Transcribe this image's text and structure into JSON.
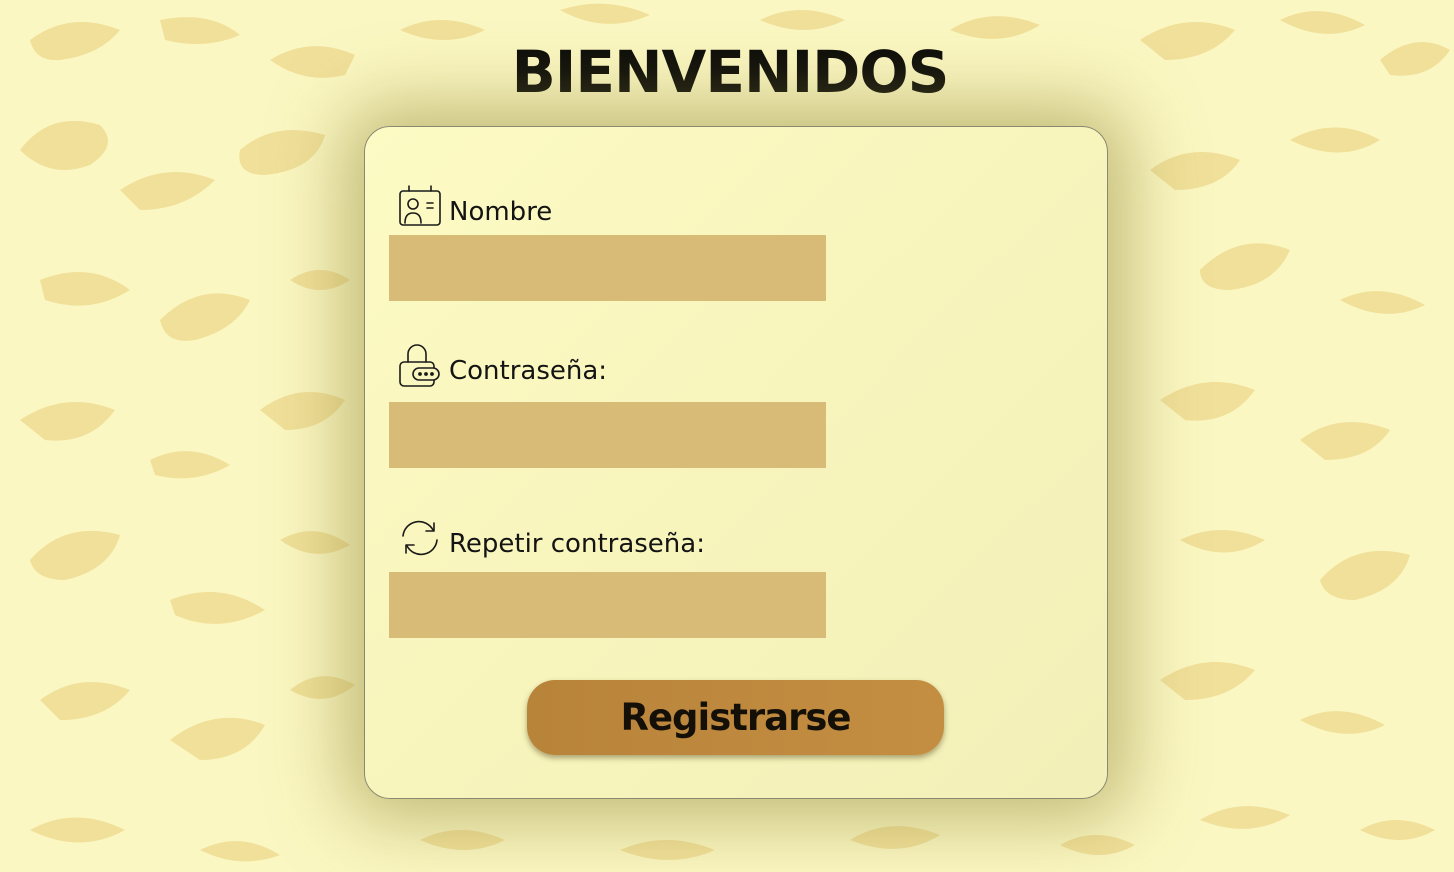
{
  "page": {
    "title": "BIENVENIDOS"
  },
  "form": {
    "fields": [
      {
        "icon": "id-badge-icon",
        "label": "Nombre",
        "value": "",
        "placeholder": ""
      },
      {
        "icon": "lock-password-icon",
        "label": "Contraseña:",
        "value": "",
        "placeholder": ""
      },
      {
        "icon": "refresh-icon",
        "label": "Repetir contraseña:",
        "value": "",
        "placeholder": ""
      }
    ],
    "submit_label": "Registrarse"
  },
  "colors": {
    "background": "#fbf7c2",
    "pattern": "#eedc94",
    "card": "#f8f6be",
    "input": "#d8bb76",
    "button": "#be8a3e",
    "text": "#141414"
  }
}
